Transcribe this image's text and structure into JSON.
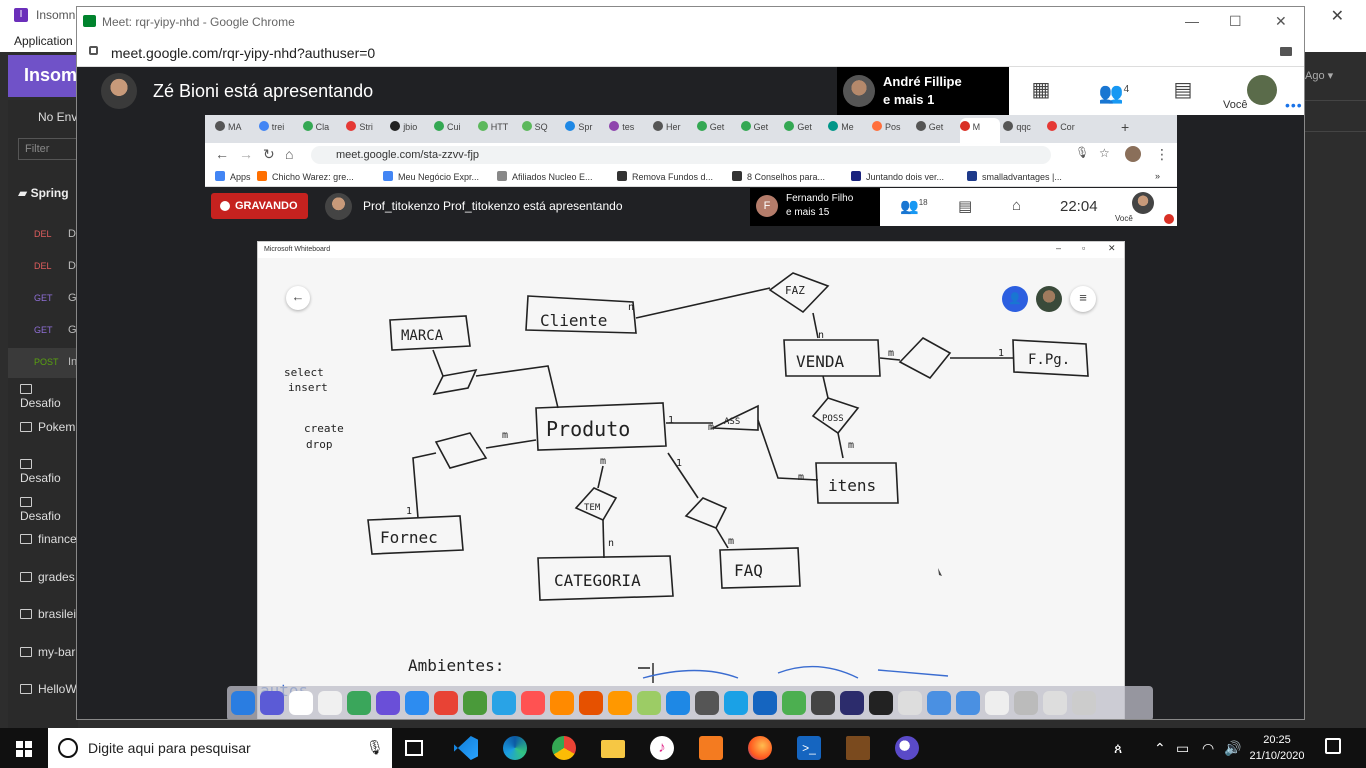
{
  "insomnia": {
    "title": "Insomni",
    "menu": "Application",
    "brand": "Insom",
    "env": "No Env",
    "filter_placeholder": "Filter",
    "workspace": "Spring",
    "right_label": "Ago",
    "requests": [
      {
        "method": "DEL",
        "letter": "D",
        "color": "#e05d5d"
      },
      {
        "method": "DEL",
        "letter": "D",
        "color": "#e05d5d"
      },
      {
        "method": "GET",
        "letter": "G",
        "color": "#8f6fd6"
      },
      {
        "method": "GET",
        "letter": "G",
        "color": "#8f6fd6"
      },
      {
        "method": "POST",
        "letter": "In",
        "color": "#59a210"
      }
    ],
    "folders": [
      "Desafio",
      "Pokem",
      "Desafio",
      "Desafio",
      "finance",
      "grades",
      "brasilei",
      "my-bar",
      "HelloW"
    ]
  },
  "chrome": {
    "window_title": "Meet: rqr-yipy-nhd - Google Chrome",
    "url": "meet.google.com/rqr-yipy-nhd?authuser=0"
  },
  "meet": {
    "presenting_text": "Zé Bioni está apresentando",
    "participant_name": "André Fillipe",
    "participant_more": "e mais 1",
    "people_count": "4",
    "you_label": "Você"
  },
  "shared": {
    "tabs": [
      {
        "label": "MA",
        "color": "#555"
      },
      {
        "label": "trei",
        "color": "#4285f4"
      },
      {
        "label": "Cla",
        "color": "#34a853"
      },
      {
        "label": "Stri",
        "color": "#e53935"
      },
      {
        "label": "jbio",
        "color": "#222"
      },
      {
        "label": "Cui",
        "color": "#34a853"
      },
      {
        "label": "HTT",
        "color": "#5cb85c"
      },
      {
        "label": "SQ",
        "color": "#5cb85c"
      },
      {
        "label": "Spr",
        "color": "#1e88e5"
      },
      {
        "label": "tes",
        "color": "#8e44ad"
      },
      {
        "label": "Her",
        "color": "#555"
      },
      {
        "label": "Get",
        "color": "#34a853"
      },
      {
        "label": "Get",
        "color": "#34a853"
      },
      {
        "label": "Get",
        "color": "#34a853"
      },
      {
        "label": "Me",
        "color": "#009688"
      },
      {
        "label": "Pos",
        "color": "#ff6f3c"
      },
      {
        "label": "Get",
        "color": "#555"
      },
      {
        "label": "M",
        "color": "#d93025"
      },
      {
        "label": "qqc",
        "color": "#555"
      },
      {
        "label": "Cor",
        "color": "#e53935"
      }
    ],
    "url": "meet.google.com/sta-zzvv-fjp",
    "bookmarks": [
      {
        "label": "Apps",
        "color": "#4285f4"
      },
      {
        "label": "Chicho Warez: gre...",
        "color": "#ff6f00"
      },
      {
        "label": "Meu Negócio Expr...",
        "color": "#4285f4"
      },
      {
        "label": "Afiliados Nucleo E...",
        "color": "#888"
      },
      {
        "label": "Remova Fundos d...",
        "color": "#333"
      },
      {
        "label": "8 Conselhos para...",
        "color": "#333"
      },
      {
        "label": "Juntando dois ver...",
        "color": "#1a237e"
      },
      {
        "label": "smalladvantages |...",
        "color": "#1e3a8a"
      }
    ],
    "recording_label": "GRAVANDO",
    "presenting_text": "Prof_titokenzo Prof_titokenzo está apresentando",
    "participant_initial": "F",
    "participant_name": "Fernando Filho",
    "participant_more": "e mais 15",
    "people_count": "18",
    "time": "22:04",
    "you_label": "Você",
    "whiteboard_title": "Microsoft Whiteboard"
  },
  "whiteboard": {
    "words": [
      "Cliente",
      "FAZ",
      "VENDA",
      "F.Pg.",
      "MARCA",
      "Produto",
      "ASS",
      "POSS",
      "itens",
      "TEM",
      "CATEGORIA",
      "FAQ",
      "Fornec",
      "select",
      "insert",
      "create",
      "drop",
      "Ambientes:",
      "autos"
    ]
  },
  "taskbar": {
    "search_placeholder": "Digite aqui para pesquisar",
    "time": "20:25",
    "date": "21/10/2020"
  }
}
